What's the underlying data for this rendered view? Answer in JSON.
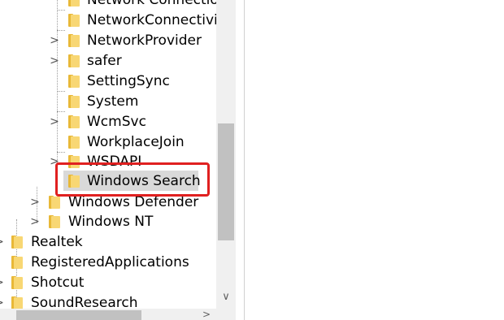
{
  "tree": {
    "items": [
      {
        "label": "Network Connectio",
        "expander": false
      },
      {
        "label": "NetworkConnectivi",
        "expander": false
      },
      {
        "label": "NetworkProvider",
        "expander": true
      },
      {
        "label": "safer",
        "expander": true
      },
      {
        "label": "SettingSync",
        "expander": false
      },
      {
        "label": "System",
        "expander": false
      },
      {
        "label": "WcmSvc",
        "expander": true
      },
      {
        "label": "WorkplaceJoin",
        "expander": false
      },
      {
        "label": "WSDAPI",
        "expander": true
      },
      {
        "label": "Windows Search",
        "expander": false,
        "selected": true
      },
      {
        "label": "Windows Defender",
        "expander": true
      },
      {
        "label": "Windows NT",
        "expander": true
      },
      {
        "label": "Realtek",
        "expander": false
      },
      {
        "label": "RegisteredApplications",
        "expander": false
      },
      {
        "label": "Shotcut",
        "expander": false
      },
      {
        "label": "SoundResearch",
        "expander": false
      }
    ]
  },
  "icons": {
    "expander": ">",
    "scroll_down": "∨",
    "scroll_right": ">"
  },
  "colors": {
    "highlight_border": "#e02020",
    "selection": "#d9d9d9",
    "folder_front": "#f8d774",
    "folder_back": "#e8b837"
  }
}
